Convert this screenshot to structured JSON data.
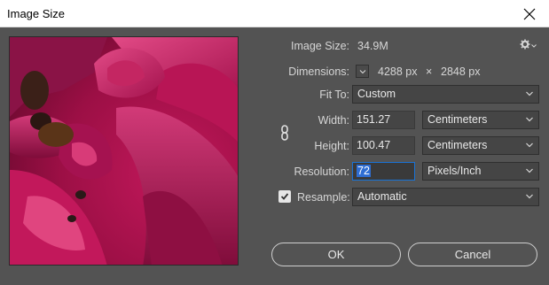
{
  "window": {
    "title": "Image Size"
  },
  "info": {
    "image_size_label": "Image Size:",
    "image_size_value": "34.9M",
    "dimensions_label": "Dimensions:",
    "dim_width": "4288 px",
    "dim_sep": "×",
    "dim_height": "2848 px"
  },
  "fit_to": {
    "label": "Fit To:",
    "value": "Custom"
  },
  "width": {
    "label": "Width:",
    "value": "151.27",
    "unit": "Centimeters"
  },
  "height": {
    "label": "Height:",
    "value": "100.47",
    "unit": "Centimeters"
  },
  "resolution": {
    "label": "Resolution:",
    "value": "72",
    "unit": "Pixels/Inch"
  },
  "resample": {
    "label": "Resample:",
    "checked": true,
    "value": "Automatic"
  },
  "buttons": {
    "ok": "OK",
    "cancel": "Cancel"
  },
  "icons": {
    "close": "close-icon",
    "gear": "gear-icon",
    "chain": "link-chain-icon",
    "chevron": "chevron-down-icon",
    "check": "check-icon"
  },
  "colors": {
    "dialog_bg": "#535353",
    "accent": "#2f6ed3",
    "field_bg": "#454545"
  }
}
